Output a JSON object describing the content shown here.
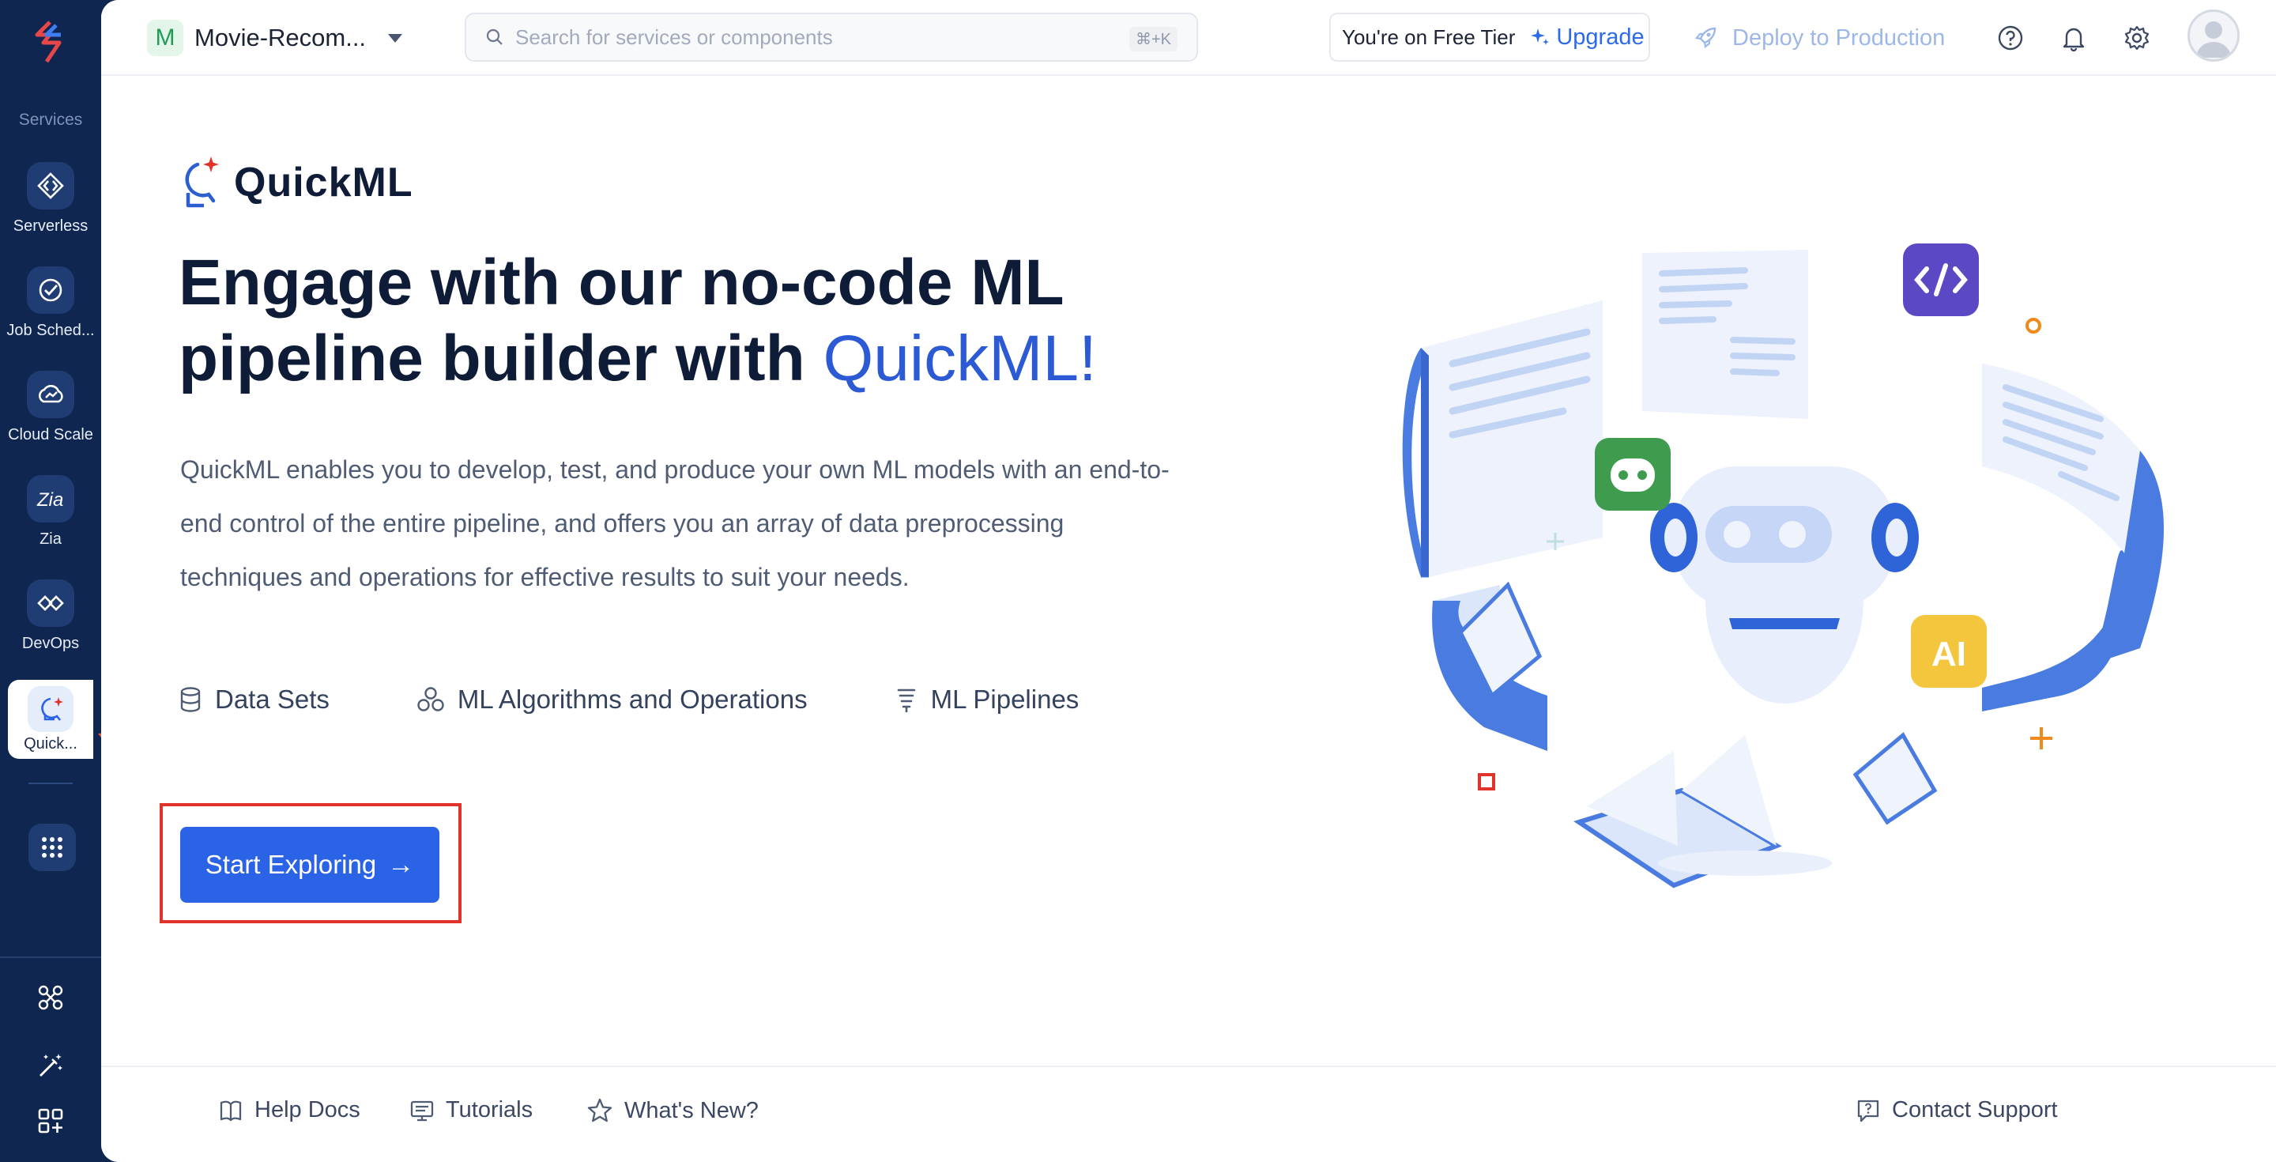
{
  "sidebar": {
    "section_label": "Services",
    "items": [
      {
        "label": "Serverless",
        "icon": "serverless-icon"
      },
      {
        "label": "Job Sched...",
        "icon": "job-scheduling-icon"
      },
      {
        "label": "Cloud Scale",
        "icon": "cloud-scale-icon"
      },
      {
        "label": "Zia",
        "icon": "zia-icon"
      },
      {
        "label": "DevOps",
        "icon": "devops-icon"
      }
    ],
    "active_item": {
      "label": "Quick...",
      "icon": "quickml-icon"
    },
    "bottom_icons": [
      "integrations-icon",
      "magic-wand-icon",
      "add-widget-icon"
    ]
  },
  "header": {
    "project_initial": "M",
    "project_name": "Movie-Recom...",
    "search_placeholder": "Search for services or components",
    "search_shortcut": "⌘+K",
    "tier_text": "You're on Free Tier",
    "upgrade_label": "Upgrade",
    "deploy_label": "Deploy to Production",
    "colors": {
      "accent": "#2b63e6",
      "sidebar": "#0e2650",
      "highlight": "#f6cf2b",
      "annotation": "#e0342a"
    }
  },
  "hero": {
    "brand": "QuickML",
    "headline_part1": "Engage with our no-code ML",
    "headline_part2": "pipeline builder with ",
    "headline_highlight": "QuickML!",
    "description": "QuickML enables you to develop, test, and produce your own ML models with an end-to-end control of the entire pipeline, and offers you an array of data preprocessing techniques and operations for effective results to suit your needs.",
    "features": [
      {
        "label": "Data Sets",
        "icon": "database-icon"
      },
      {
        "label": "ML Algorithms and Operations",
        "icon": "algorithms-icon"
      },
      {
        "label": "ML Pipelines",
        "icon": "pipeline-icon"
      }
    ],
    "cta_label": "Start Exploring",
    "cta_arrow": "→",
    "illustration_badge_text": "AI"
  },
  "footer": {
    "links": [
      {
        "label": "Help Docs",
        "icon": "book-icon"
      },
      {
        "label": "Tutorials",
        "icon": "tutorial-icon"
      },
      {
        "label": "What's New?",
        "icon": "star-icon"
      }
    ],
    "support_label": "Contact Support"
  }
}
